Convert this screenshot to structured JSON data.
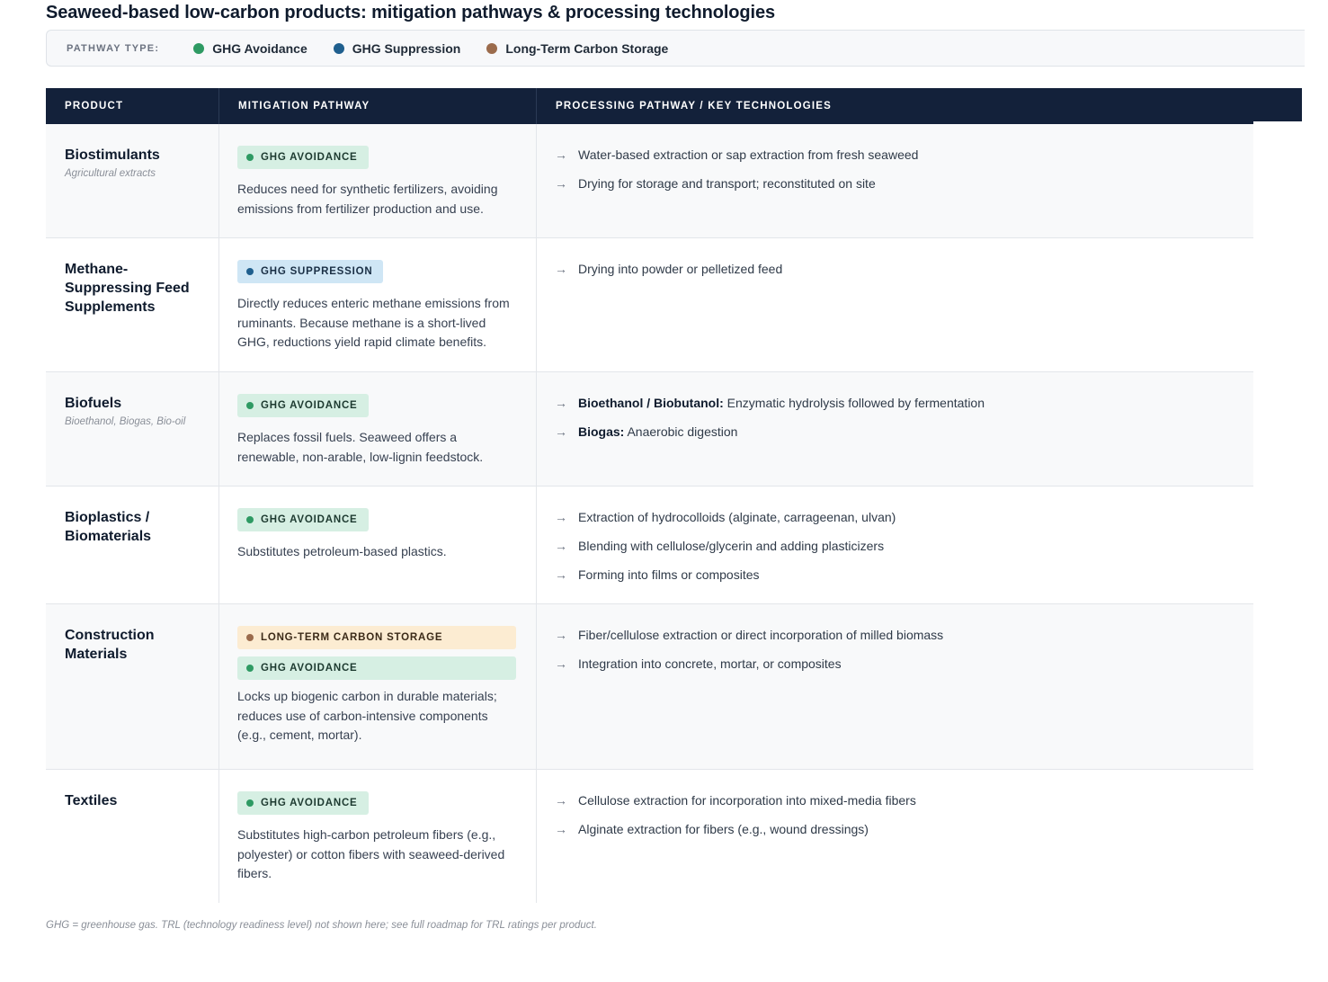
{
  "title": "Seaweed-based low-carbon products: mitigation pathways & processing technologies",
  "legend": {
    "label": "PATHWAY TYPE:",
    "items": [
      {
        "label": "GHG Avoidance",
        "color": "#2e9a63"
      },
      {
        "label": "GHG Suppression",
        "color": "#1f5f8e"
      },
      {
        "label": "Long-Term Carbon Storage",
        "color": "#9b6b4c"
      }
    ]
  },
  "table": {
    "headers": [
      "PRODUCT",
      "MITIGATION PATHWAY",
      "PROCESSING PATHWAY / KEY TECHNOLOGIES"
    ],
    "rows": [
      {
        "product": "Biostimulants",
        "subtitle": "Agricultural extracts",
        "badges": [
          "GHG AVOIDANCE"
        ],
        "description": "Reduces need for synthetic fertilizers, avoiding emissions from fertilizer production and use.",
        "processing": [
          {
            "bold": "",
            "text": "Water-based extraction or sap extraction from fresh seaweed"
          },
          {
            "bold": "",
            "text": "Drying for storage and transport; reconstituted on site"
          }
        ]
      },
      {
        "product": "Methane-Suppressing Feed Supplements",
        "subtitle": "",
        "badges": [
          "GHG SUPPRESSION"
        ],
        "description": "Directly reduces enteric methane emissions from ruminants. Because methane is a short-lived GHG, reductions yield rapid climate benefits.",
        "processing": [
          {
            "bold": "",
            "text": "Drying into powder or pelletized feed"
          }
        ]
      },
      {
        "product": "Biofuels",
        "subtitle": "Bioethanol, Biogas, Bio-oil",
        "badges": [
          "GHG AVOIDANCE"
        ],
        "description": "Replaces fossil fuels. Seaweed offers a renewable, non-arable, low-lignin feedstock.",
        "processing": [
          {
            "bold": "Bioethanol / Biobutanol:",
            "text": " Enzymatic hydrolysis followed by fermentation"
          },
          {
            "bold": "Biogas:",
            "text": " Anaerobic digestion"
          }
        ]
      },
      {
        "product": "Bioplastics / Biomaterials",
        "subtitle": "",
        "badges": [
          "GHG AVOIDANCE"
        ],
        "description": "Substitutes petroleum-based plastics.",
        "processing": [
          {
            "bold": "",
            "text": "Extraction of hydrocolloids (alginate, carrageenan, ulvan)"
          },
          {
            "bold": "",
            "text": "Blending with cellulose/glycerin and adding plasticizers"
          },
          {
            "bold": "",
            "text": "Forming into films or composites"
          }
        ]
      },
      {
        "product": "Construction Materials",
        "subtitle": "",
        "badges": [
          "LONG-TERM CARBON STORAGE",
          "GHG AVOIDANCE"
        ],
        "description": "Locks up biogenic carbon in durable materials; reduces use of carbon-intensive components (e.g., cement, mortar).",
        "processing": [
          {
            "bold": "",
            "text": "Fiber/cellulose extraction or direct incorporation of milled biomass"
          },
          {
            "bold": "",
            "text": "Integration into concrete, mortar, or composites"
          }
        ]
      },
      {
        "product": "Textiles",
        "subtitle": "",
        "badges": [
          "GHG AVOIDANCE"
        ],
        "description": "Substitutes high-carbon petroleum fibers (e.g., polyester) or cotton fibers with seaweed-derived fibers.",
        "processing": [
          {
            "bold": "",
            "text": "Cellulose extraction for incorporation into mixed-media fibers"
          },
          {
            "bold": "",
            "text": "Alginate extraction for fibers (e.g., wound dressings)"
          }
        ]
      }
    ]
  },
  "footnote": "GHG = greenhouse gas. TRL (technology readiness level) not shown here; see full roadmap for TRL ratings per product.",
  "arrow_glyph": "→"
}
